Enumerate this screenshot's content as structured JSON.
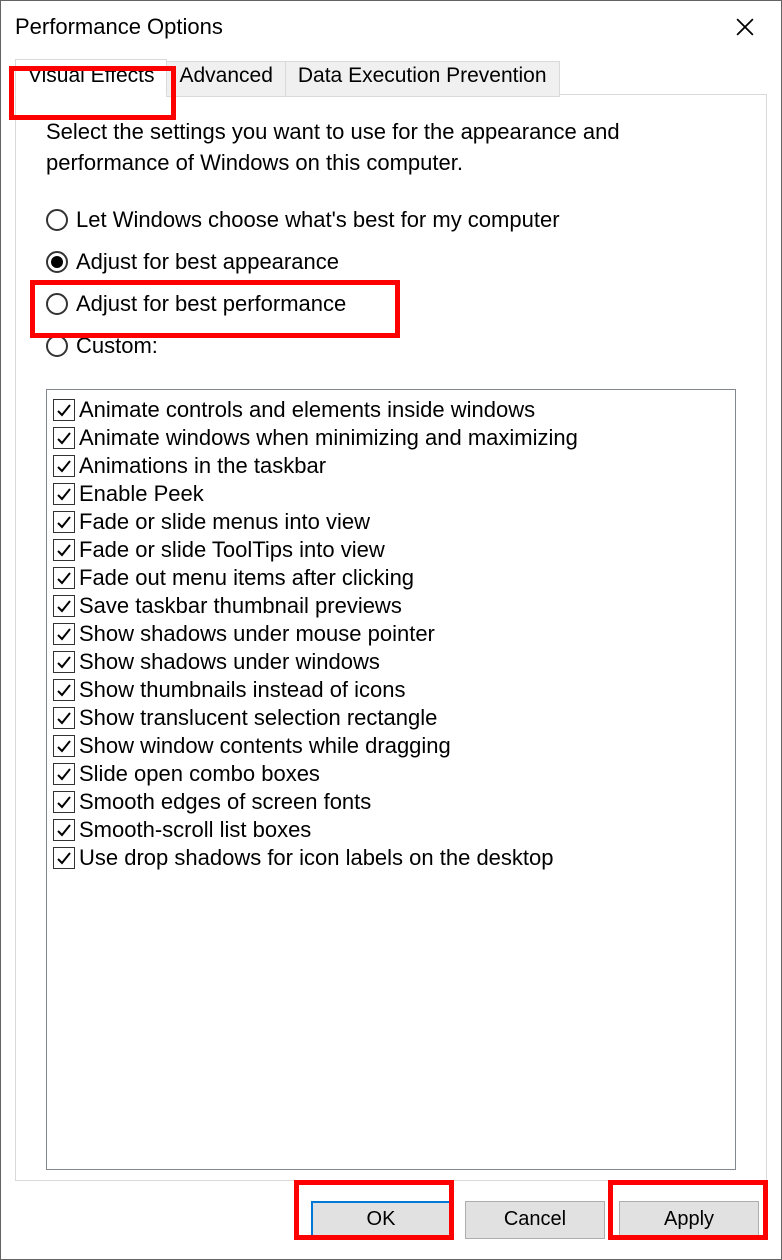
{
  "window": {
    "title": "Performance Options"
  },
  "tabs": [
    {
      "label": "Visual Effects",
      "active": true
    },
    {
      "label": "Advanced",
      "active": false
    },
    {
      "label": "Data Execution Prevention",
      "active": false
    }
  ],
  "description": "Select the settings you want to use for the appearance and performance of Windows on this computer.",
  "radios": [
    {
      "label": "Let Windows choose what's best for my computer",
      "selected": false
    },
    {
      "label": "Adjust for best appearance",
      "selected": true
    },
    {
      "label": "Adjust for best performance",
      "selected": false
    },
    {
      "label": "Custom:",
      "selected": false
    }
  ],
  "checkboxes": [
    {
      "label": "Animate controls and elements inside windows",
      "checked": true
    },
    {
      "label": "Animate windows when minimizing and maximizing",
      "checked": true
    },
    {
      "label": "Animations in the taskbar",
      "checked": true
    },
    {
      "label": "Enable Peek",
      "checked": true
    },
    {
      "label": "Fade or slide menus into view",
      "checked": true
    },
    {
      "label": "Fade or slide ToolTips into view",
      "checked": true
    },
    {
      "label": "Fade out menu items after clicking",
      "checked": true
    },
    {
      "label": "Save taskbar thumbnail previews",
      "checked": true
    },
    {
      "label": "Show shadows under mouse pointer",
      "checked": true
    },
    {
      "label": "Show shadows under windows",
      "checked": true
    },
    {
      "label": "Show thumbnails instead of icons",
      "checked": true
    },
    {
      "label": "Show translucent selection rectangle",
      "checked": true
    },
    {
      "label": "Show window contents while dragging",
      "checked": true
    },
    {
      "label": "Slide open combo boxes",
      "checked": true
    },
    {
      "label": "Smooth edges of screen fonts",
      "checked": true
    },
    {
      "label": "Smooth-scroll list boxes",
      "checked": true
    },
    {
      "label": "Use drop shadows for icon labels on the desktop",
      "checked": true
    }
  ],
  "buttons": {
    "ok": "OK",
    "cancel": "Cancel",
    "apply": "Apply"
  }
}
